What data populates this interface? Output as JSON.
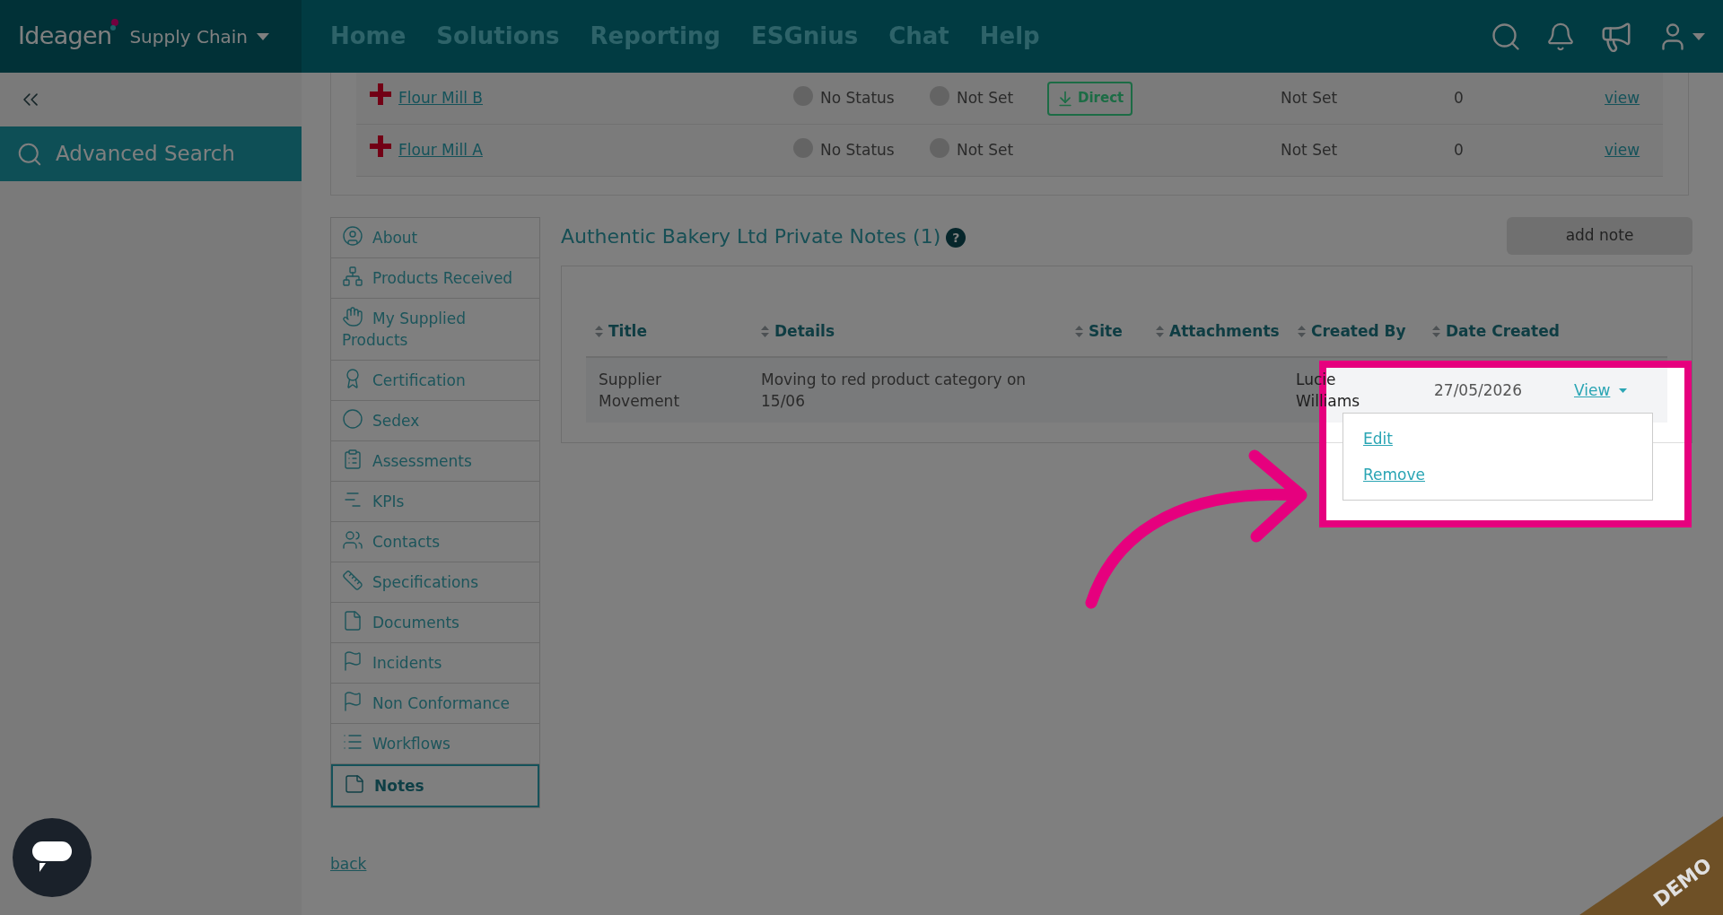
{
  "header": {
    "brand": "Ideagen",
    "product": "Supply Chain",
    "nav": [
      "Home",
      "Solutions",
      "Reporting",
      "ESGnius",
      "Chat",
      "Help"
    ]
  },
  "sidebar": {
    "search": "Advanced Search"
  },
  "suppliers": [
    {
      "name": "Flour Mill B",
      "status": "No Status",
      "rating": "Not Set",
      "relation": "Direct",
      "column_6": "Not Set",
      "count": "0",
      "link": "view"
    },
    {
      "name": "Flour Mill A",
      "status": "No Status",
      "rating": "Not Set",
      "column_6": "Not Set",
      "count": "0",
      "link": "view"
    }
  ],
  "menu": [
    {
      "label": "About",
      "selected": false
    },
    {
      "label": "Products Received",
      "selected": false
    },
    {
      "label": "My Supplied Products",
      "selected": false
    },
    {
      "label": "Certification",
      "selected": false
    },
    {
      "label": "Sedex",
      "selected": false
    },
    {
      "label": "Assessments",
      "selected": false
    },
    {
      "label": "KPIs",
      "selected": false
    },
    {
      "label": "Contacts",
      "selected": false
    },
    {
      "label": "Specifications",
      "selected": false
    },
    {
      "label": "Documents",
      "selected": false
    },
    {
      "label": "Incidents",
      "selected": false
    },
    {
      "label": "Non Conformance",
      "selected": false
    },
    {
      "label": "Workflows",
      "selected": false
    },
    {
      "label": "Notes",
      "selected": true
    }
  ],
  "notes": {
    "title": "Authentic Bakery Ltd Private Notes (1)",
    "help": "?",
    "add_button": "add note",
    "columns": [
      "Title",
      "Details",
      "Site",
      "Attachments",
      "Created By",
      "Date Created"
    ],
    "rows": [
      {
        "title": "Supplier Movement",
        "details": "Moving to red product category on 15/06",
        "created_by": "Lucie Williams",
        "date": "27/05/2026",
        "action": "View",
        "expanded": true,
        "menu": [
          "Edit",
          "Remove"
        ]
      }
    ]
  },
  "back": "back",
  "demo": "DEMO"
}
